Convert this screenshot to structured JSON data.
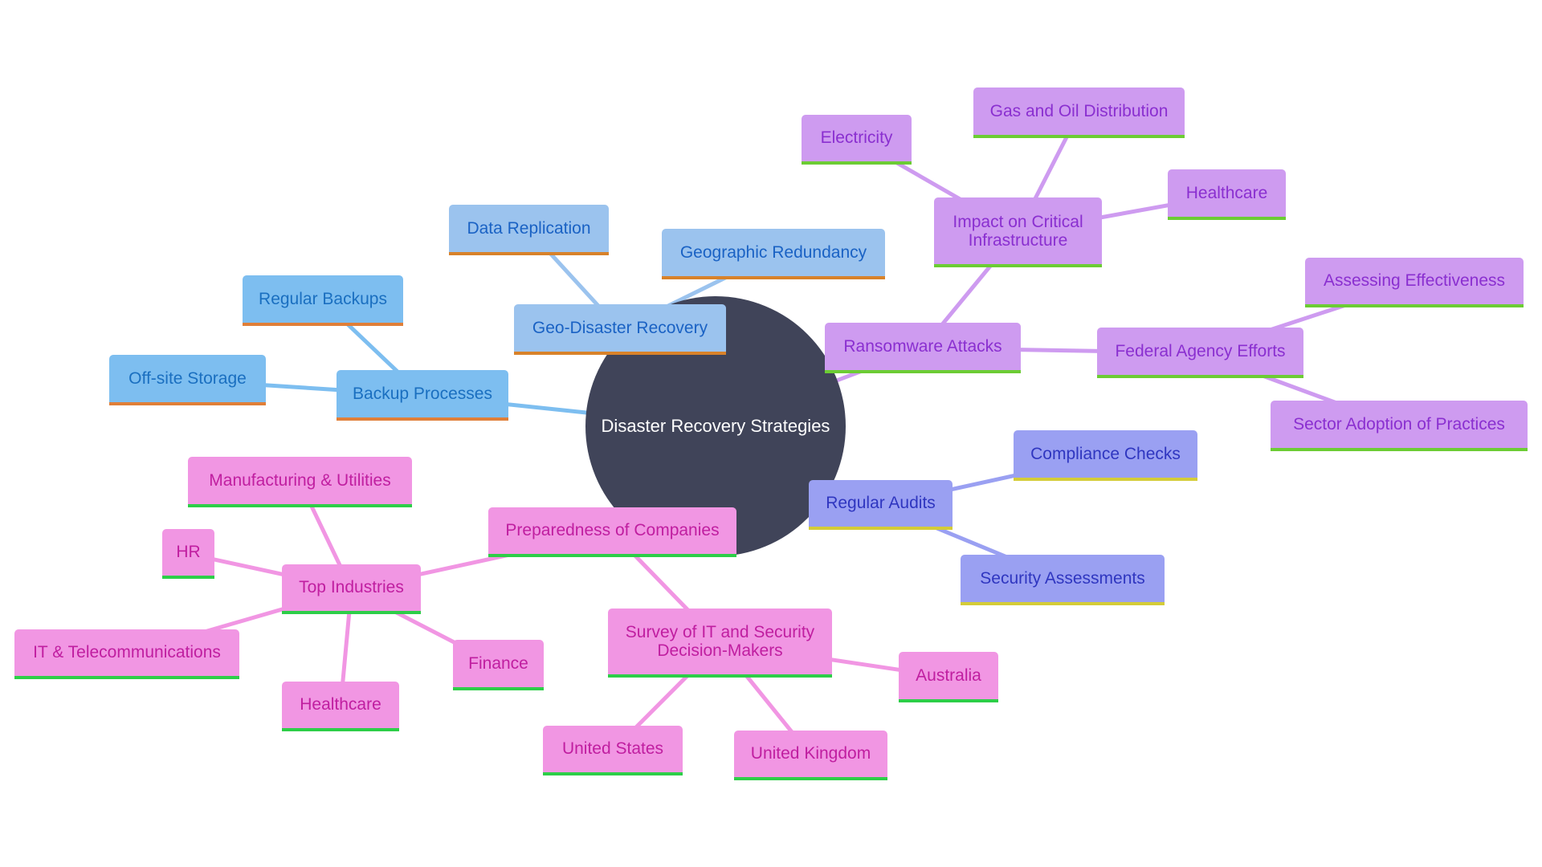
{
  "diagram": {
    "type": "mindmap",
    "root": {
      "label": "Disaster Recovery Strategies",
      "color": "#404459"
    },
    "branches": [
      {
        "label": "Backup Processes",
        "colors": {
          "fill": "#7dbef0",
          "text": "#1a6fc0",
          "accent": "#e07f38",
          "edge": "#7dbef0"
        },
        "children": [
          {
            "label": "Regular Backups"
          },
          {
            "label": "Off-site Storage"
          }
        ]
      },
      {
        "label": "Geo-Disaster Recovery",
        "colors": {
          "fill": "#9bc3ee",
          "text": "#1a62c4",
          "accent": "#d8822a",
          "edge": "#9bc3ee"
        },
        "children": [
          {
            "label": "Data Replication"
          },
          {
            "label": "Geographic Redundancy"
          }
        ]
      },
      {
        "label": "Ransomware Attacks",
        "colors": {
          "fill": "#ce9bf0",
          "text": "#8a2fd0",
          "accent": "#6ccc34",
          "edge": "#ce9bf0"
        },
        "children": [
          {
            "label": "Impact on Critical Infrastructure",
            "label_lines": [
              "Impact on Critical",
              "Infrastructure"
            ],
            "children": [
              {
                "label": "Electricity"
              },
              {
                "label": "Gas and Oil Distribution"
              },
              {
                "label": "Healthcare"
              }
            ]
          },
          {
            "label": "Federal Agency Efforts",
            "children": [
              {
                "label": "Assessing Effectiveness"
              },
              {
                "label": "Sector Adoption of Practices"
              }
            ]
          }
        ]
      },
      {
        "label": "Regular Audits",
        "colors": {
          "fill": "#9aa0f2",
          "text": "#2f36c0",
          "accent": "#d4cc38",
          "edge": "#9aa0f2"
        },
        "children": [
          {
            "label": "Compliance Checks"
          },
          {
            "label": "Security Assessments"
          }
        ]
      },
      {
        "label": "Preparedness of Companies",
        "colors": {
          "fill": "#f196e3",
          "text": "#c01ea0",
          "accent": "#2dce48",
          "edge": "#f196e3"
        },
        "children": [
          {
            "label": "Top Industries",
            "children": [
              {
                "label": "Manufacturing & Utilities"
              },
              {
                "label": "HR"
              },
              {
                "label": "IT & Telecommunications"
              },
              {
                "label": "Healthcare"
              },
              {
                "label": "Finance"
              }
            ]
          },
          {
            "label": "Survey of IT and Security Decision-Makers",
            "label_lines": [
              "Survey of IT and Security",
              "Decision-Makers"
            ],
            "children": [
              {
                "label": "Australia"
              },
              {
                "label": "United States"
              },
              {
                "label": "United Kingdom"
              }
            ]
          }
        ]
      }
    ]
  }
}
